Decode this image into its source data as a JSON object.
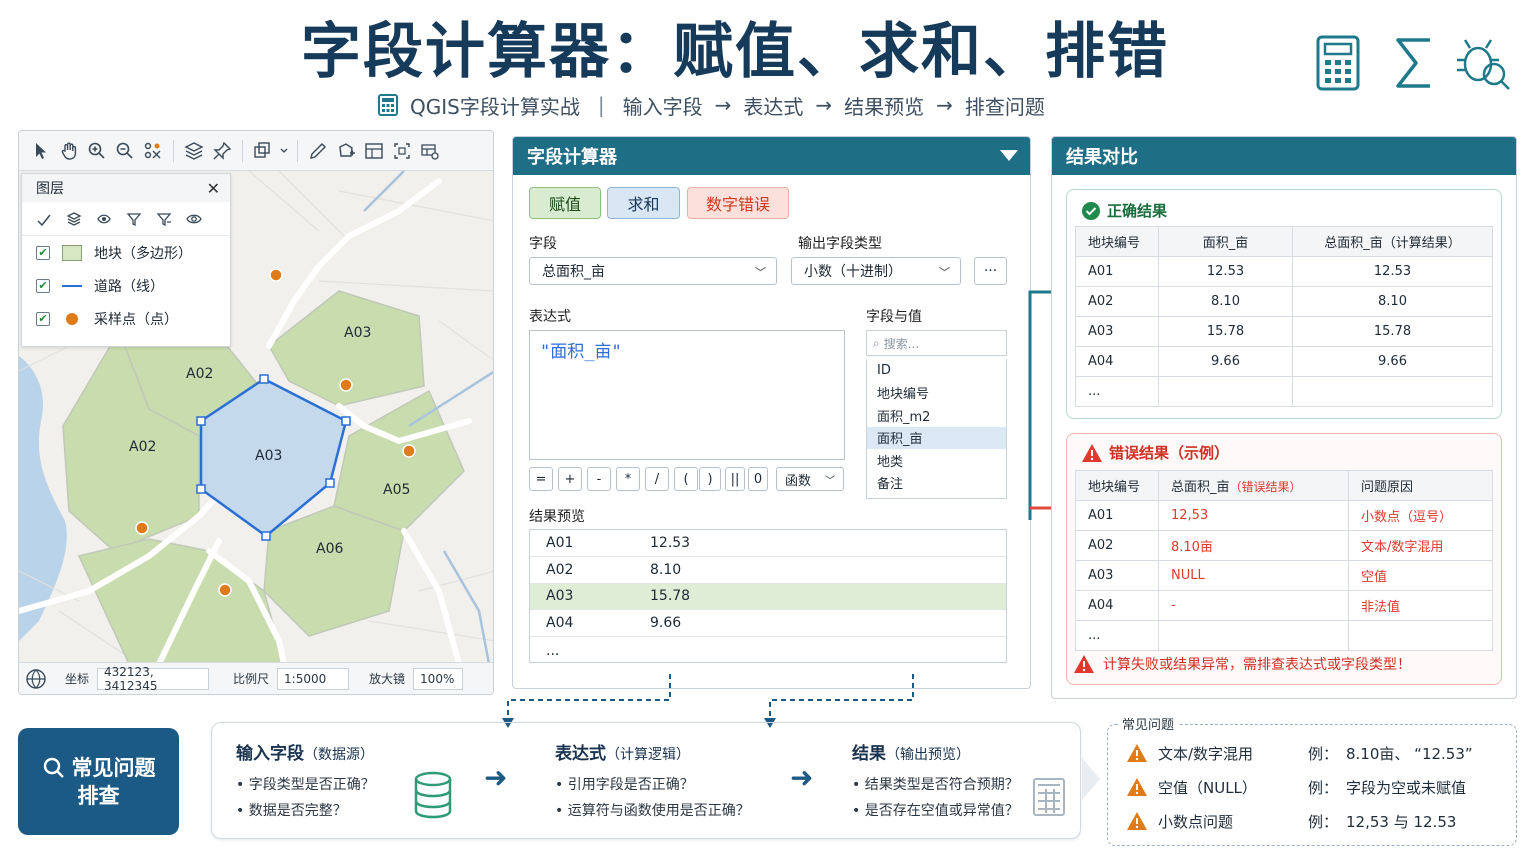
{
  "header": {
    "title": "字段计算器：赋值、求和、排错",
    "subtitle_app": "QGIS字段计算实战",
    "steps": [
      "输入字段",
      "表达式",
      "结果预览",
      "排查问题"
    ]
  },
  "map": {
    "layers_title": "图层",
    "layers": [
      {
        "label": "地块（多边形）",
        "checked": true
      },
      {
        "label": "道路（线）",
        "checked": true
      },
      {
        "label": "采样点（点）",
        "checked": true
      }
    ],
    "parcels": [
      "A02",
      "A02",
      "A03",
      "A03",
      "A05",
      "A06"
    ],
    "status": {
      "coord_label": "坐标",
      "coord_value": "432123, 3412345",
      "scale_label": "比例尺",
      "scale_value": "1:5000",
      "zoom_label": "放大镜",
      "zoom_value": "100%"
    },
    "colors": {
      "parcel": "#c9dcae",
      "selected": "#c5d9ec",
      "road": "#ffffff",
      "water": "#b9d3ea",
      "point": "#e07b1c"
    }
  },
  "calculator": {
    "title": "字段计算器",
    "tabs": [
      "赋值",
      "求和",
      "数字错误"
    ],
    "field_label": "字段",
    "field_value": "总面积_亩",
    "out_type_label": "输出字段类型",
    "out_type_value": "小数（十进制）",
    "more_label": "···",
    "expr_label": "表达式",
    "expr_value": "\"面积_亩\"",
    "operators": [
      "=",
      "+",
      "-",
      "*",
      "/",
      "(",
      ")",
      "||",
      "0"
    ],
    "func_label": "函数",
    "fv_label": "字段与值",
    "fv_search_placeholder": "搜索...",
    "fv_items": [
      "ID",
      "地块编号",
      "面积_m2",
      "面积_亩",
      "地类",
      "备注"
    ],
    "preview_label": "结果预览",
    "preview_rows": [
      [
        "A01",
        "12.53"
      ],
      [
        "A02",
        "8.10"
      ],
      [
        "A03",
        "15.78"
      ],
      [
        "A04",
        "9.66"
      ],
      [
        "...",
        ""
      ]
    ]
  },
  "results": {
    "title": "结果对比",
    "correct_title": "正确结果",
    "correct_headers": [
      "地块编号",
      "面积_亩",
      "总面积_亩（计算结果）"
    ],
    "correct_rows": [
      [
        "A01",
        "12.53",
        "12.53"
      ],
      [
        "A02",
        "8.10",
        "8.10"
      ],
      [
        "A03",
        "15.78",
        "15.78"
      ],
      [
        "A04",
        "9.66",
        "9.66"
      ],
      [
        "...",
        "",
        ""
      ]
    ],
    "error_title": "错误结果（示例）",
    "error_headers": [
      "地块编号",
      "总面积_亩",
      "（错误结果）",
      "问题原因"
    ],
    "error_rows": [
      [
        "A01",
        "12,53",
        "小数点（逗号）"
      ],
      [
        "A02",
        "8.10亩",
        "文本/数字混用"
      ],
      [
        "A03",
        "NULL",
        "空值"
      ],
      [
        "A04",
        "-",
        "非法值"
      ],
      [
        "...",
        "",
        ""
      ]
    ],
    "error_note": "计算失败或结果异常，需排查表达式或字段类型！"
  },
  "flow": {
    "faq_button": [
      "常见问题",
      "排查"
    ],
    "steps": [
      {
        "title": "输入字段",
        "sub": "（数据源）",
        "items": [
          "字段类型是否正确？",
          "数据是否完整？"
        ]
      },
      {
        "title": "表达式",
        "sub": "（计算逻辑）",
        "items": [
          "引用字段是否正确？",
          "运算符与函数使用是否正确？"
        ]
      },
      {
        "title": "结果",
        "sub": "（输出预览）",
        "items": [
          "结果类型是否符合预期？",
          "是否存在空值或异常值？"
        ]
      }
    ]
  },
  "faq": {
    "title": "常见问题",
    "rows": [
      {
        "issue": "文本/数字混用",
        "ex_label": "例：",
        "example": "8.10亩、 “12.53”"
      },
      {
        "issue": "空值（NULL）",
        "ex_label": "例：",
        "example": "字段为空或未赋值"
      },
      {
        "issue": "小数点问题",
        "ex_label": "例：",
        "example": "12,53 与 12.53"
      }
    ]
  }
}
